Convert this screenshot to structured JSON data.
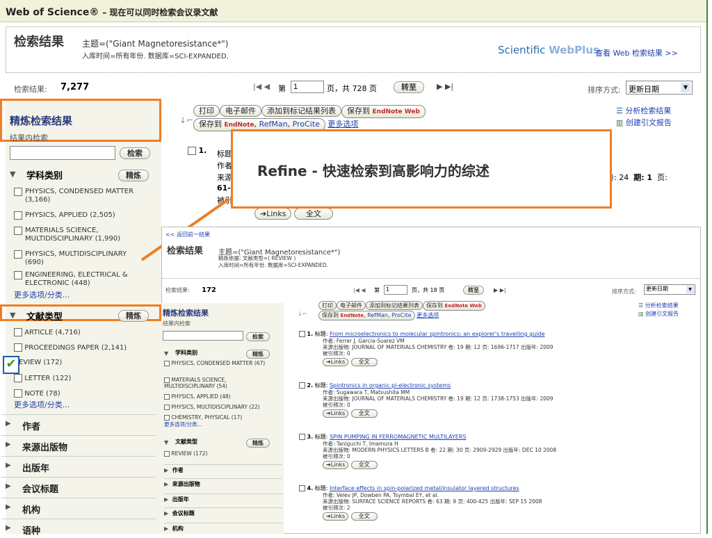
{
  "header": {
    "brand": "Web of Science®",
    "subtitle": "– 现在可以同时检索会议录文献"
  },
  "results": {
    "title": "检索结果",
    "query": "主题=(\"Giant Magnetoresistance*\")",
    "query_sub": "入库时间=所有年份. 数据库=SCI-EXPANDED.",
    "webplus_logo_a": "Scientific ",
    "webplus_logo_b": "WebPlus",
    "webplus_link": "查看 Web 检索结果 >>",
    "count_label": "检索结果:",
    "count": "7,277",
    "page_prefix": "第",
    "page_value": "1",
    "page_suffix": "页，共 728 页",
    "goto": "转至",
    "sort_label": "排序方式:",
    "sort_value": "更新日期"
  },
  "toolbar": {
    "print": "打印",
    "email": "电子邮件",
    "add_marked": "添加到标记结果列表",
    "save_to": "保存到",
    "endnote_web": "EndNote Web",
    "save_to2": "保存到",
    "endnote": "EndNote",
    "refman": "RefMan",
    "procite": "ProCite",
    "more": "更多选项",
    "analyze": "分析检索结果",
    "citation_report": "创建引文报告"
  },
  "refine": {
    "title": "精炼检索结果",
    "within": "结果内检索",
    "search_btn": "检索",
    "subject_label": "学科类别",
    "refine_btn": "精炼",
    "subjects": [
      "PHYSICS, CONDENSED MATTER (3,166)",
      "PHYSICS, APPLIED (2,505)",
      "MATERIALS SCIENCE, MULTIDISCIPLINARY (1,990)",
      "PHYSICS, MULTIDISCIPLINARY (690)",
      "ENGINEERING, ELECTRICAL & ELECTRONIC (448)"
    ],
    "more": "更多选项/分类...",
    "doctype_label": "文献类型",
    "doctypes": [
      "ARTICLE (4,716)",
      "PROCEEDINGS PAPER (2,141)",
      "REVIEW (172)",
      "LETTER (122)",
      "NOTE (78)"
    ],
    "more2": "更多选项/分类...",
    "sections": [
      "作者",
      "来源出版物",
      "出版年",
      "会议标题",
      "机构",
      "语种"
    ]
  },
  "record1": {
    "num": "1.",
    "title_lbl": "标题",
    "author_lbl": "作者",
    "source_lbl": "来源",
    "pages_prefix": "61-",
    "cited_lbl": "被引",
    "volume": "卷: 24",
    "issue": "期: 1",
    "pages_lbl": "页:",
    "links": "Links",
    "fulltext": "全文"
  },
  "callout": {
    "text": "Refine - 快速检索到高影响力的综述"
  },
  "inner": {
    "back": "<< 返回前一结果",
    "title": "检索结果",
    "query": "主题=(\"Giant Magnetoresistance*\")",
    "refined": "精炼依据: 文献类型=( REVIEW )",
    "query_sub": "入库时间=所有年份. 数据库=SCI-EXPANDED.",
    "count_label": "检索结果:",
    "count": "172",
    "page_prefix": "第",
    "page_value": "1",
    "page_suffix": "页，共 18 页",
    "goto": "转至",
    "sort_label": "排序方式:",
    "sort_value": "更新日期",
    "refine_title": "精炼检索结果",
    "within": "结果内检索",
    "search_btn": "检索",
    "subject_label": "学科类别",
    "refine_btn": "精炼",
    "subjects": [
      "PHYSICS, CONDENSED MATTER (67)",
      "MATERIALS SCIENCE, MULTIDISCIPLINARY (54)",
      "PHYSICS, APPLIED (48)",
      "PHYSICS, MULTIDISCIPLINARY (22)",
      "CHEMISTRY, PHYSICAL (17)"
    ],
    "more": "更多选项/分类...",
    "doctype_label": "文献类型",
    "doctype": "REVIEW (172)",
    "sections": [
      "作者",
      "来源出版物",
      "出版年",
      "会议标题",
      "机构"
    ],
    "records": [
      {
        "num": "1.",
        "title": "From microelectronics to molecular spintronics: an explorer's travelling guide",
        "authors": "作者: Ferrer J, Garcia-Suarez VM",
        "source": "来源出版物: JOURNAL OF MATERIALS CHEMISTRY 卷: 19 期: 12 页: 1696-1717 出版年: 2009",
        "cited": "被引频次: 0"
      },
      {
        "num": "2.",
        "title": "Spintronics in organic pi-electronic systems",
        "authors": "作者: Sugawara T, Matsushita MM",
        "source": "来源出版物: JOURNAL OF MATERIALS CHEMISTRY 卷: 19 期: 12 页: 1738-1753 出版年: 2009",
        "cited": "被引频次: 0"
      },
      {
        "num": "3.",
        "title": "SPIN PUMPING IN FERROMAGNETIC MULTILAYERS",
        "authors": "作者: Taniguchi T, Imamura H",
        "source": "来源出版物: MODERN PHYSICS LETTERS B 卷: 22 期: 30 页: 2909-2929 出版年: DEC 10 2008",
        "cited": "被引频次: 0"
      },
      {
        "num": "4.",
        "title": "Interface effects in spin-polarized metal/insulator layered structures",
        "authors": "作者: Velev JP, Dowben PA, Tsymbal EY, et al.",
        "source": "来源出版物: SURFACE SCIENCE REPORTS 卷: 63 期: 9 页: 400-425 出版年: SEP 15 2008",
        "cited": "被引频次: 2"
      }
    ],
    "title_lbl": "标题:",
    "links": "Links",
    "fulltext": "全文"
  }
}
